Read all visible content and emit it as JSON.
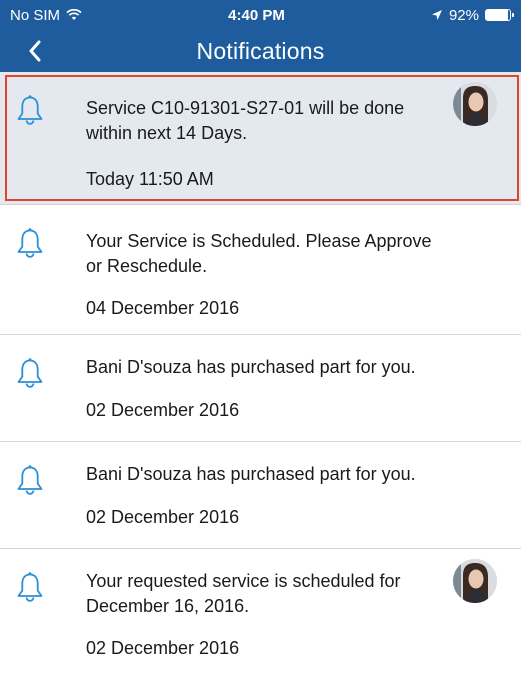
{
  "status_bar": {
    "carrier": "No SIM",
    "time": "4:40 PM",
    "battery": "92%",
    "battery_level": 0.92
  },
  "header": {
    "title": "Notifications"
  },
  "notifications": [
    {
      "message": "Service C10-91301-S27-01 will be done within next 14 Days.",
      "time": "Today 11:50 AM"
    },
    {
      "message": "Your Service is Scheduled. Please Approve or Reschedule.",
      "time": "04 December 2016"
    },
    {
      "message": "Bani D'souza has purchased part for you.",
      "time": "02 December 2016"
    },
    {
      "message": "Bani D'souza has purchased part for you.",
      "time": "02 December 2016"
    },
    {
      "message": "Your requested service is scheduled for December 16, 2016.",
      "time": "02 December 2016"
    }
  ],
  "colors": {
    "header_bg": "#1f5c9e",
    "bell_icon": "#2a8fd6",
    "highlight_bg": "#e4e9ef",
    "highlight_border": "#e0432f"
  }
}
